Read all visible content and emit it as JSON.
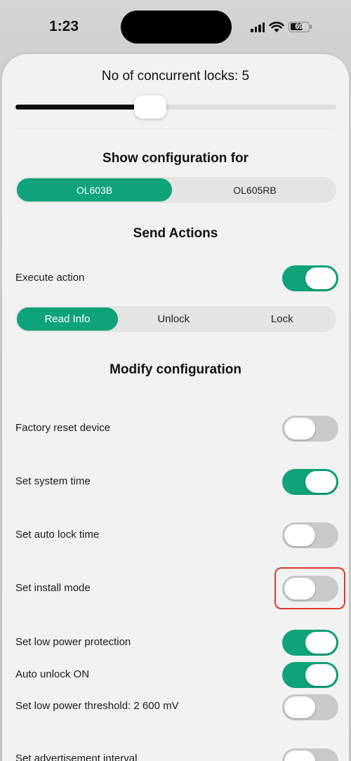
{
  "status_bar": {
    "time": "1:23",
    "battery": "69",
    "battery_level": 0.69
  },
  "slider": {
    "label": "No of concurrent locks: 5",
    "fraction": 0.42
  },
  "config": {
    "title": "Show configuration for",
    "options": [
      "OL603B",
      "OL605RB"
    ],
    "selected": "OL603B"
  },
  "send_actions": {
    "title": "Send Actions",
    "execute_label": "Execute action",
    "execute_on": true,
    "actions": [
      "Read Info",
      "Unlock",
      "Lock"
    ],
    "selected": "Read Info"
  },
  "modify": {
    "title": "Modify configuration",
    "rows": [
      {
        "label": "Factory reset device",
        "on": false
      },
      {
        "label": "Set system time",
        "on": true
      },
      {
        "label": "Set auto lock time",
        "on": false
      },
      {
        "label": "Set install mode",
        "on": false,
        "highlighted": true
      },
      {
        "label": "Set low power protection",
        "on": true
      },
      {
        "label": "Auto unlock ON",
        "on": true
      },
      {
        "label": "Set low power threshold: 2 600 mV",
        "on": false
      },
      {
        "label": "Set advertisement interval",
        "on": false
      }
    ]
  },
  "colors": {
    "accent": "#0fa37a",
    "highlight": "#d93a2b"
  }
}
